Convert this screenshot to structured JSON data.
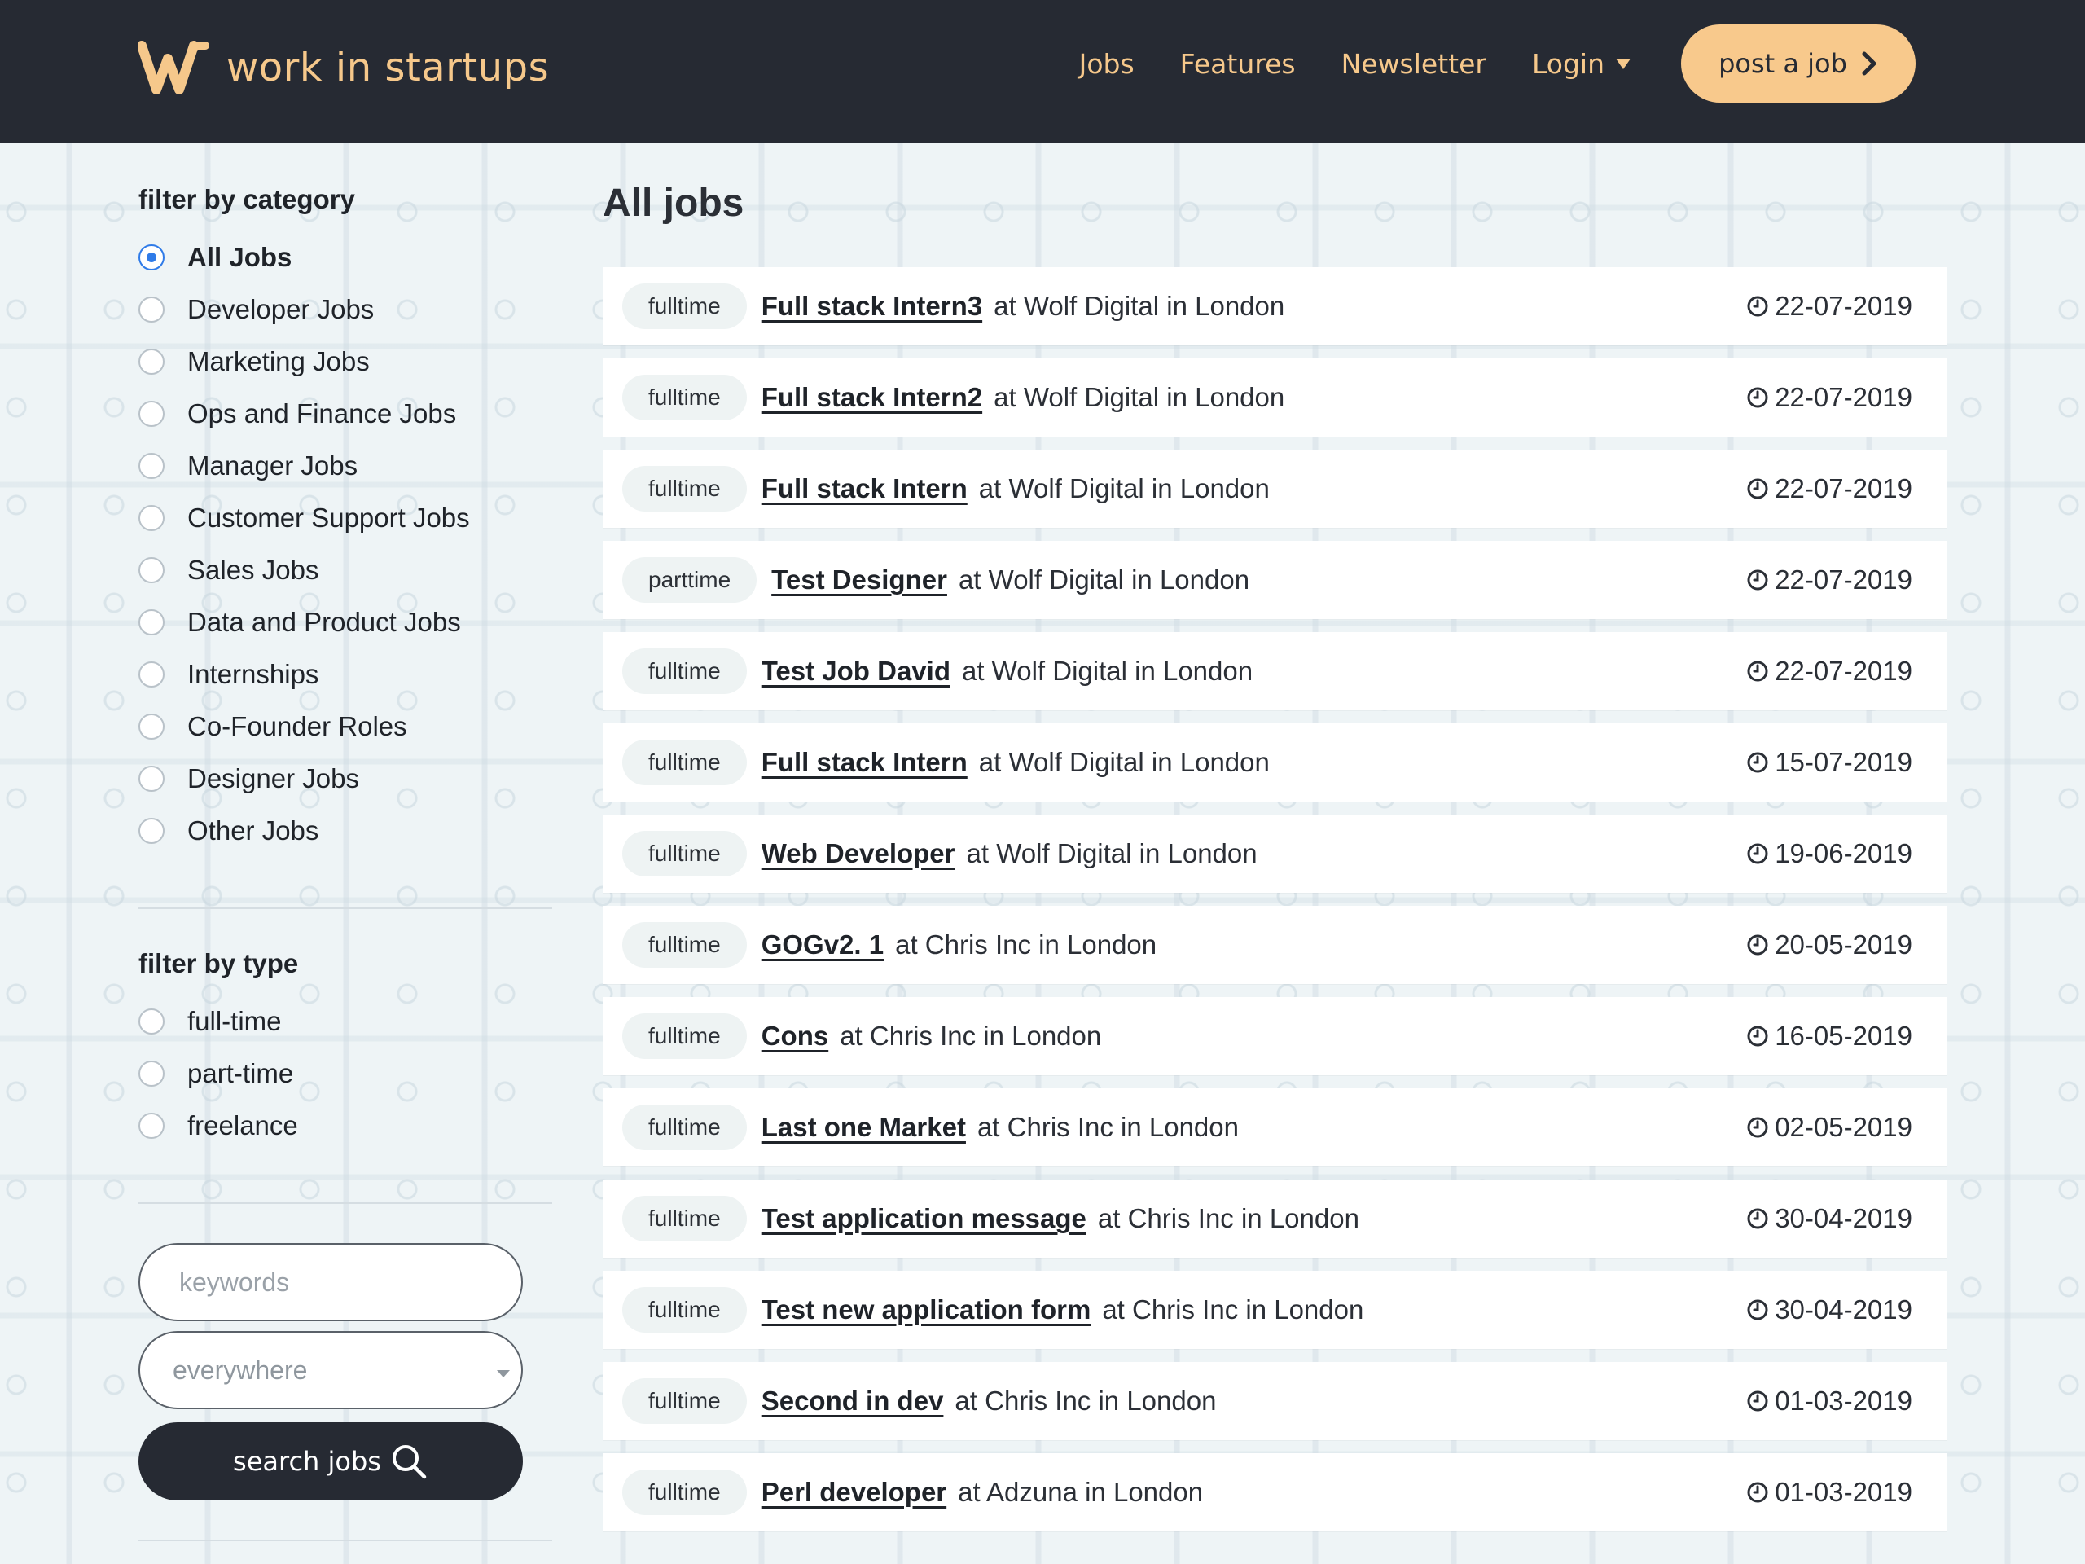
{
  "header": {
    "brand": "work in startups",
    "nav": [
      "Jobs",
      "Features",
      "Newsletter"
    ],
    "login": "Login",
    "post_job": "post a job",
    "colors": {
      "bar": "#262a33",
      "accent": "#f6c88b"
    }
  },
  "sidebar": {
    "category_heading": "filter by category",
    "categories": [
      "All Jobs",
      "Developer Jobs",
      "Marketing Jobs",
      "Ops and Finance Jobs",
      "Manager Jobs",
      "Customer Support Jobs",
      "Sales Jobs",
      "Data and Product Jobs",
      "Internships",
      "Co-Founder Roles",
      "Designer Jobs",
      "Other Jobs"
    ],
    "selected_category": "All Jobs",
    "type_heading": "filter by type",
    "types": [
      "full-time",
      "part-time",
      "freelance"
    ],
    "keywords_placeholder": "keywords",
    "location_value": "everywhere",
    "search_button": "search jobs"
  },
  "main": {
    "title": "All jobs",
    "jobs": [
      {
        "type": "fulltime",
        "title": "Full stack Intern3",
        "company": "at Wolf Digital in London",
        "date": "22-07-2019"
      },
      {
        "type": "fulltime",
        "title": "Full stack Intern2",
        "company": "at Wolf Digital in London",
        "date": "22-07-2019"
      },
      {
        "type": "fulltime",
        "title": "Full stack Intern",
        "company": "at Wolf Digital in London",
        "date": "22-07-2019"
      },
      {
        "type": "parttime",
        "title": "Test Designer",
        "company": "at Wolf Digital in London",
        "date": "22-07-2019"
      },
      {
        "type": "fulltime",
        "title": "Test Job David",
        "company": "at Wolf Digital in London",
        "date": "22-07-2019"
      },
      {
        "type": "fulltime",
        "title": "Full stack Intern",
        "company": "at Wolf Digital in London",
        "date": "15-07-2019"
      },
      {
        "type": "fulltime",
        "title": "Web Developer",
        "company": "at Wolf Digital in London",
        "date": "19-06-2019"
      },
      {
        "type": "fulltime",
        "title": "GOGv2. 1",
        "company": "at Chris Inc in London",
        "date": "20-05-2019"
      },
      {
        "type": "fulltime",
        "title": "Cons",
        "company": "at Chris Inc in London",
        "date": "16-05-2019"
      },
      {
        "type": "fulltime",
        "title": "Last one Market",
        "company": "at Chris Inc in London",
        "date": "02-05-2019"
      },
      {
        "type": "fulltime",
        "title": "Test application message",
        "company": "at Chris Inc in London",
        "date": "30-04-2019"
      },
      {
        "type": "fulltime",
        "title": "Test new application form",
        "company": "at Chris Inc in London",
        "date": "30-04-2019"
      },
      {
        "type": "fulltime",
        "title": "Second in dev",
        "company": "at Chris Inc in London",
        "date": "01-03-2019"
      },
      {
        "type": "fulltime",
        "title": "Perl developer",
        "company": "at Adzuna in London",
        "date": "01-03-2019"
      }
    ]
  }
}
